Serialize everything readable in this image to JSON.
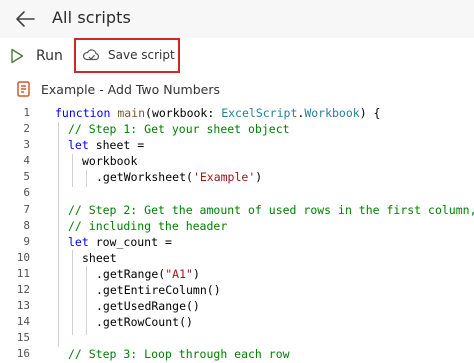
{
  "header": {
    "title": "All scripts"
  },
  "toolbar": {
    "run_label": "Run",
    "save_label": "Save script"
  },
  "script": {
    "name": "Example - Add Two Numbers"
  },
  "code": {
    "line_numbers": [
      "1",
      "2",
      "3",
      "4",
      "5",
      "6",
      "7",
      "8",
      "9",
      "10",
      "11",
      "12",
      "13",
      "14",
      "15",
      "16"
    ],
    "lines": [
      "function main(workbook: ExcelScript.Workbook) {",
      "// Step 1: Get your sheet object",
      "let sheet =",
      "workbook",
      ".getWorksheet('Example')",
      "",
      "// Step 2: Get the amount of used rows in the first column,",
      "// including the header",
      "let row_count =",
      "sheet",
      ".getRange(\"A1\")",
      ".getEntireColumn()",
      ".getUsedRange()",
      ".getRowCount()",
      "",
      "// Step 3: Loop through each row"
    ]
  },
  "colors": {
    "highlight_border": "#cc2a2a",
    "keyword": "#0000ff",
    "comment": "#008000",
    "string": "#a31515",
    "type": "#267f99",
    "script_icon": "#d9572b"
  }
}
